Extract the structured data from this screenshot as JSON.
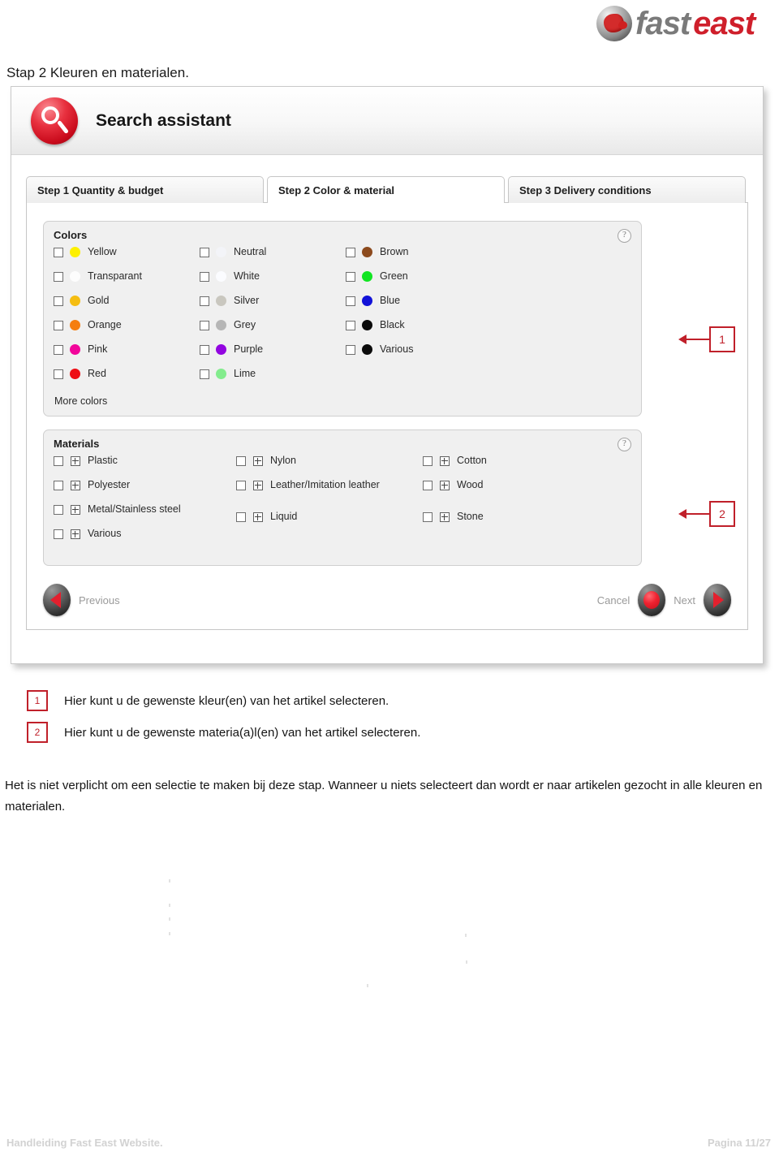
{
  "brand": {
    "logo_text_part1": "fast",
    "logo_text_part2": "east",
    "accent_red": "#cf1f2b",
    "logo_gray": "#7a7a7a"
  },
  "page_heading": "Stap 2 Kleuren en materialen.",
  "app": {
    "title": "Search assistant",
    "search_icon": "magnifier-icon",
    "tabs": [
      {
        "label": "Step 1 Quantity & budget",
        "active": false
      },
      {
        "label": "Step 2 Color & material",
        "active": true
      },
      {
        "label": "Step 3 Delivery conditions",
        "active": false
      }
    ],
    "colors_group": {
      "title": "Colors",
      "help_icon": "question-mark-icon",
      "more_link": "More colors",
      "columns": [
        [
          {
            "label": "Yellow",
            "swatch": "#fdf000",
            "checked": false
          },
          {
            "label": "Transparant",
            "swatch": "#fdfdfd",
            "checked": false
          },
          {
            "label": "Gold",
            "swatch": "#f5bd11",
            "checked": false
          },
          {
            "label": "Orange",
            "swatch": "#f57e10",
            "checked": false
          },
          {
            "label": "Pink",
            "swatch": "#f2069b",
            "checked": false
          },
          {
            "label": "Red",
            "swatch": "#ee0d14",
            "checked": false
          }
        ],
        [
          {
            "label": "Neutral",
            "swatch": "#f3f4f8",
            "checked": false
          },
          {
            "label": "White",
            "swatch": "#fbfcff",
            "checked": false
          },
          {
            "label": "Silver",
            "swatch": "#c9c7bf",
            "checked": false
          },
          {
            "label": "Grey",
            "swatch": "#b6b6b6",
            "checked": false
          },
          {
            "label": "Purple",
            "swatch": "#9205e0",
            "checked": false
          },
          {
            "label": "Lime",
            "swatch": "#83ec8d",
            "checked": false
          }
        ],
        [
          {
            "label": "Brown",
            "swatch": "#8c4a1d",
            "checked": false
          },
          {
            "label": "Green",
            "swatch": "#11e522",
            "checked": false
          },
          {
            "label": "Blue",
            "swatch": "#1212d8",
            "checked": false
          },
          {
            "label": "Black",
            "swatch": "#0b0b0b",
            "checked": false
          },
          {
            "label": "Various",
            "swatch": "#0b0b0b",
            "checked": false
          }
        ]
      ]
    },
    "materials_group": {
      "title": "Materials",
      "help_icon": "question-mark-icon",
      "columns": [
        [
          {
            "label": "Plastic",
            "checked": false,
            "expandable": true
          },
          {
            "label": "Polyester",
            "checked": false,
            "expandable": true
          },
          {
            "label": "Metal/Stainless steel",
            "checked": false,
            "expandable": true
          },
          {
            "label": "Various",
            "checked": false,
            "expandable": true
          }
        ],
        [
          {
            "label": "Nylon",
            "checked": false,
            "expandable": true
          },
          {
            "label": "Leather/Imitation leather",
            "checked": false,
            "expandable": true
          },
          {
            "label": "Liquid",
            "checked": false,
            "expandable": true
          }
        ],
        [
          {
            "label": "Cotton",
            "checked": false,
            "expandable": true
          },
          {
            "label": "Wood",
            "checked": false,
            "expandable": true
          },
          {
            "label": "Stone",
            "checked": false,
            "expandable": true
          }
        ]
      ]
    },
    "footer": {
      "previous_label": "Previous",
      "cancel_label": "Cancel",
      "next_label": "Next"
    }
  },
  "callouts": [
    {
      "number": "1"
    },
    {
      "number": "2"
    }
  ],
  "legend": [
    {
      "number": "1",
      "text": "Hier kunt u de gewenste kleur(en) van het artikel selecteren."
    },
    {
      "number": "2",
      "text": "Hier kunt u de gewenste materia(a)l(en) van het artikel selecteren."
    }
  ],
  "note": "Het is niet verplicht om een selectie te maken bij deze stap. Wanneer u niets selecteert dan wordt er naar artikelen gezocht in alle kleuren en materialen.",
  "page_footer": {
    "left": "Handleiding Fast East Website.",
    "right": "Pagina 11/27"
  }
}
